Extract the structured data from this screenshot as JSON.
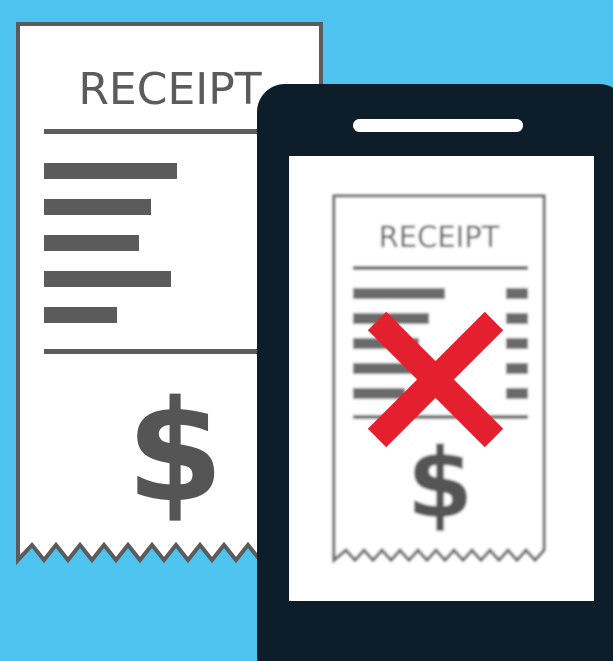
{
  "illustration": {
    "background_color": "#4fc3ef",
    "paper_receipt": {
      "title": "RECEIPT",
      "currency_symbol": "$",
      "line_color": "#5b5b5b",
      "line_item_count": 5
    },
    "phone": {
      "body_color": "#0d1e2a",
      "screen_receipt": {
        "title": "RECEIPT",
        "currency_symbol": "$",
        "blurred": true
      },
      "reject_mark_color": "#e4202e"
    }
  }
}
